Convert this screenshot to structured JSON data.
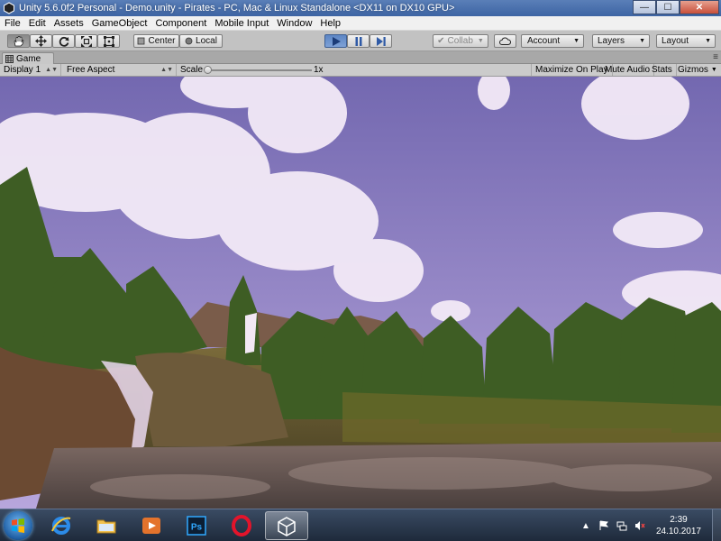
{
  "window": {
    "title": "Unity 5.6.0f2 Personal - Demo.unity - Pirates - PC, Mac & Linux Standalone <DX11 on DX10 GPU>",
    "minimize_glyph": "—",
    "maximize_glyph": "☐",
    "close_glyph": "✕"
  },
  "menu": [
    "File",
    "Edit",
    "Assets",
    "GameObject",
    "Component",
    "Mobile Input",
    "Window",
    "Help"
  ],
  "toolbar": {
    "tools": [
      "hand-tool",
      "move-tool",
      "rotate-tool",
      "scale-tool",
      "rect-tool"
    ],
    "pivot_label": "Center",
    "space_label": "Local",
    "play_icon": "play-icon",
    "pause_icon": "pause-icon",
    "step_icon": "step-icon",
    "collab_label": "Collab",
    "account_label": "Account",
    "layers_label": "Layers",
    "layout_label": "Layout"
  },
  "game_tab": {
    "label": "Game",
    "display": "Display 1",
    "aspect": "Free Aspect",
    "scale_label": "Scale",
    "scale_value": "1x",
    "maximize_on_play": "Maximize On Play",
    "mute_audio": "Mute Audio",
    "stats": "Stats",
    "gizmos": "Gizmos",
    "menu_glyph": "≡"
  },
  "taskbar": {
    "apps": [
      "start-button",
      "internet-explorer",
      "file-explorer",
      "media-player",
      "photoshop",
      "opera",
      "unity"
    ],
    "time": "2:39",
    "date": "24.10.2017"
  },
  "colors": {
    "titlebar": "#3d64a3",
    "toolbar": "#c2c2c2",
    "play_active": "#5d86c4",
    "sky_top": "#7368b0",
    "sky_bottom": "#b7a6dc"
  }
}
